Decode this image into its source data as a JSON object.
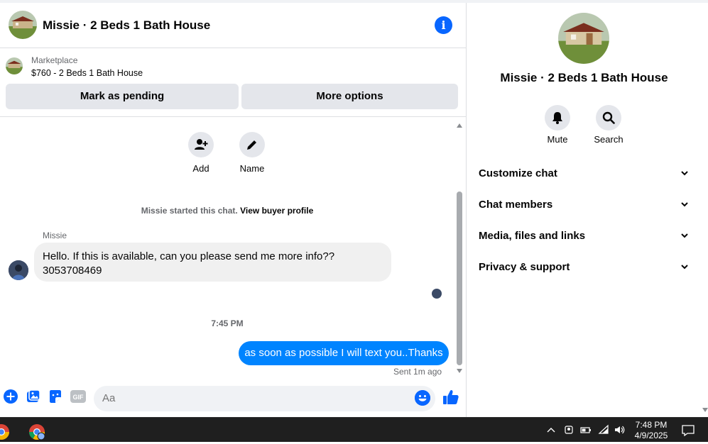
{
  "chat": {
    "title": "Missie · 2 Beds 1 Bath House",
    "marketplace_label": "Marketplace",
    "listing_price_title": "$760 - 2 Beds 1 Bath House",
    "mark_pending_label": "Mark as pending",
    "more_options_label": "More options"
  },
  "conversation": {
    "add_label": "Add",
    "name_label": "Name",
    "started_prefix": "Missie started this chat.",
    "view_profile_label": "View buyer profile",
    "sender_name": "Missie",
    "incoming_line1": "Hello. If this is available, can you please send me more info??",
    "incoming_line2": "3053708469",
    "time_divider": "7:45 PM",
    "outgoing_message": "as soon as possible I will text you..Thanks",
    "sent_status": "Sent 1m ago"
  },
  "composer": {
    "placeholder": "Aa",
    "icons": [
      "plus-icon",
      "photo-icon",
      "sticker-icon",
      "gif-icon",
      "emoji-icon",
      "thumbs-up-icon"
    ]
  },
  "info": {
    "title": "Missie · 2 Beds 1 Bath House",
    "mute_label": "Mute",
    "search_label": "Search",
    "sections": [
      "Customize chat",
      "Chat members",
      "Media, files and links",
      "Privacy & support"
    ]
  },
  "taskbar": {
    "time": "7:48 PM",
    "date": "4/9/2025"
  },
  "colors": {
    "accent": "#0866ff",
    "outgoing_bubble": "#0084ff",
    "incoming_bubble": "#f0f0f0",
    "button_grey": "#e4e6eb"
  }
}
